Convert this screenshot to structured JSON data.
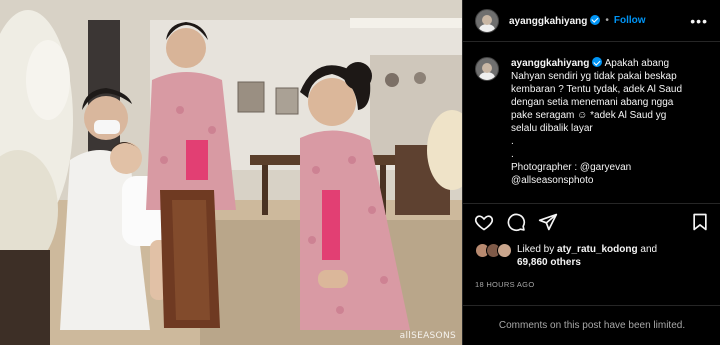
{
  "post": {
    "username": "ayanggkahiyang",
    "follow_label": "Follow",
    "more_label": "•••",
    "caption_lines": [
      "Apakah abang",
      "Nahyan sendiri yg tidak pakai beskap",
      "kembaran ? Tentu tydak, adek Al Saud",
      "dengan setia menemani abang ngga",
      "pake seragam ☺ *adek Al Saud yg",
      "selalu dibalik layar",
      ".",
      ".",
      "Photographer : @garyevan",
      "@allseasonsphoto"
    ],
    "liked_by_prefix": "Liked by ",
    "liked_by_user": "aty_ratu_kodong",
    "liked_and": " and",
    "likes_count": "69,860 others",
    "timestamp": "18 HOURS AGO",
    "comments_limited": "Comments on this post have been limited.",
    "watermark": "allSEASONS"
  },
  "colors": {
    "accent": "#0095f6",
    "background": "#000000",
    "muted": "#a8a8a8",
    "divider": "#262626"
  },
  "icons": {
    "like": "heart-icon",
    "comment": "comment-icon",
    "share": "paper-plane-icon",
    "save": "bookmark-icon",
    "verified": "verified-badge-icon"
  }
}
